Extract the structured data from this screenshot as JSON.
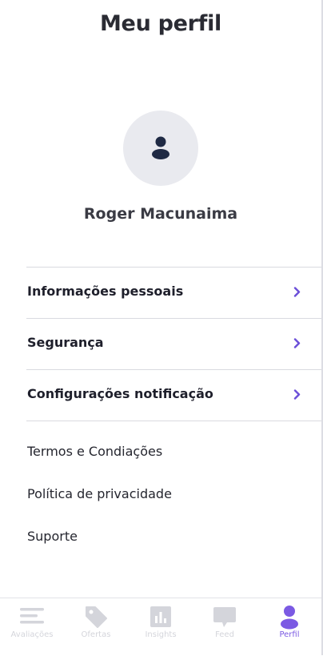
{
  "header": {
    "title": "Meu perfil"
  },
  "profile": {
    "name": "Roger Macunaima"
  },
  "menu": [
    {
      "label": "Informações pessoais"
    },
    {
      "label": "Segurança"
    },
    {
      "label": "Configurações notificação"
    }
  ],
  "links": [
    {
      "label": "Termos e Condiações"
    },
    {
      "label": "Política de privacidade"
    },
    {
      "label": "Suporte"
    }
  ],
  "tabbar": {
    "active": "Perfil",
    "tabs": [
      {
        "label": "Avaliações",
        "icon": "list-icon"
      },
      {
        "label": "Ofertas",
        "icon": "tag-icon"
      },
      {
        "label": "Insights",
        "icon": "bar-chart-icon"
      },
      {
        "label": "Feed",
        "icon": "chat-bubble-icon"
      },
      {
        "label": "Perfil",
        "icon": "user-icon"
      }
    ]
  },
  "colors": {
    "accent": "#7b5ae3",
    "text": "#1e1f2b",
    "inactive": "#d4d5db",
    "avatar_bg": "#e9eaef",
    "divider": "#d9dae0"
  }
}
